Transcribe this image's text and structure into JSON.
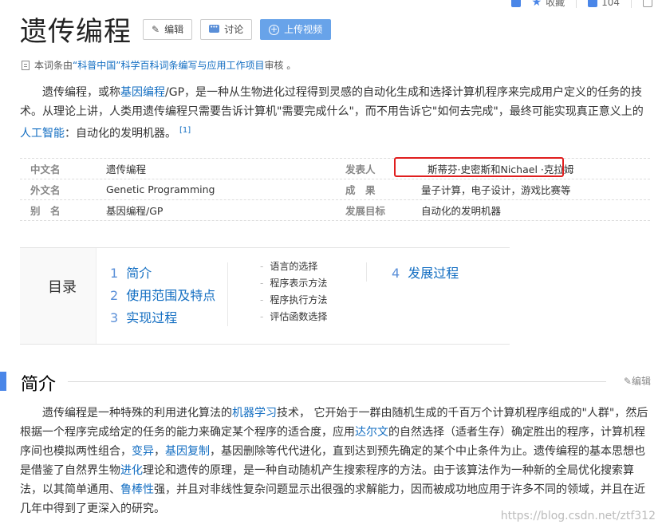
{
  "toolbar": {
    "collect_label": "收藏",
    "like_count": "104"
  },
  "header": {
    "title": "遗传编程",
    "edit_label": "编辑",
    "discuss_label": "讨论",
    "upload_label": "上传视频"
  },
  "notice": {
    "prefix": "本词条由",
    "org": "“科普中国”科学百科词条编写与应用工作项目",
    "suffix": " 审核 。"
  },
  "intro": {
    "t1": "遗传编程，或称",
    "l1": "基因编程",
    "t2": "/GP，是一种从生物进化过程得到灵感的自动化生成和选择计算机程序来完成用户定义的任务的技术。从理论上讲，人类用遗传编程只需要告诉计算机\"需要完成什么\"，而不用告诉它\"如何去完成\"，最终可能实现真正意义上的",
    "l2": "人工智能",
    "t3": "：自动化的发明机器。",
    "ref": "[1]"
  },
  "basic_info": [
    {
      "k1": "中文名",
      "v1": "遗传编程",
      "k2": "发表人",
      "v2": "斯蒂芬·史密斯和Nichael ·克拉姆"
    },
    {
      "k1": "外文名",
      "v1": "Genetic Programming",
      "k2": "成　果",
      "v2": "量子计算，电子设计，游戏比赛等"
    },
    {
      "k1": "别　名",
      "v1": "基因编程/GP",
      "k2": "发展目标",
      "v2": "自动化的发明机器"
    }
  ],
  "toc": {
    "title": "目录",
    "items": [
      {
        "num": "1",
        "label": "简介"
      },
      {
        "num": "2",
        "label": "使用范围及特点"
      },
      {
        "num": "3",
        "label": "实现过程"
      },
      {
        "num": "4",
        "label": "发展过程"
      }
    ],
    "subs": [
      "语言的选择",
      "程序表示方法",
      "程序执行方法",
      "评估函数选择"
    ]
  },
  "section": {
    "title": "简介",
    "edit_label": "编辑"
  },
  "body": {
    "t1": "遗传编程是一种特殊的利用进化算法的",
    "l1": "机器学习",
    "t2": "技术， 它开始于一群由随机生成的千百万个计算机程序组成的\"人群\"，然后根据一个程序完成给定的任务的能力来确定某个程序的适合度，应用",
    "l2": "达尔文",
    "t3": "的自然选择（适者生存）确定胜出的程序，计算机程序间也模拟两性组合，",
    "l3": "变异",
    "t4": "，",
    "l4": "基因复制",
    "t5": "，基因删除等代代进化，直到达到预先确定的某个中止条件为止。遗传编程的基本思想也是借鉴了自然界生物",
    "l5": "进化",
    "t6": "理论和遗传的原理，是一种自动随机产生搜索程序的方法。由于该算法作为一种新的全局优化搜索算法，以其简单通用、",
    "l6": "鲁棒性",
    "t7": "强，并且对非线性复杂问题显示出很强的求解能力，因而被成功地应用于许多不同的领域，并且在近几年中得到了更深入的研究。"
  },
  "watermark": "https://blog.csdn.net/ztf312",
  "colors": {
    "accent": "#4a86e8",
    "link": "#136ec2",
    "highlight_border": "#e01e1e"
  }
}
